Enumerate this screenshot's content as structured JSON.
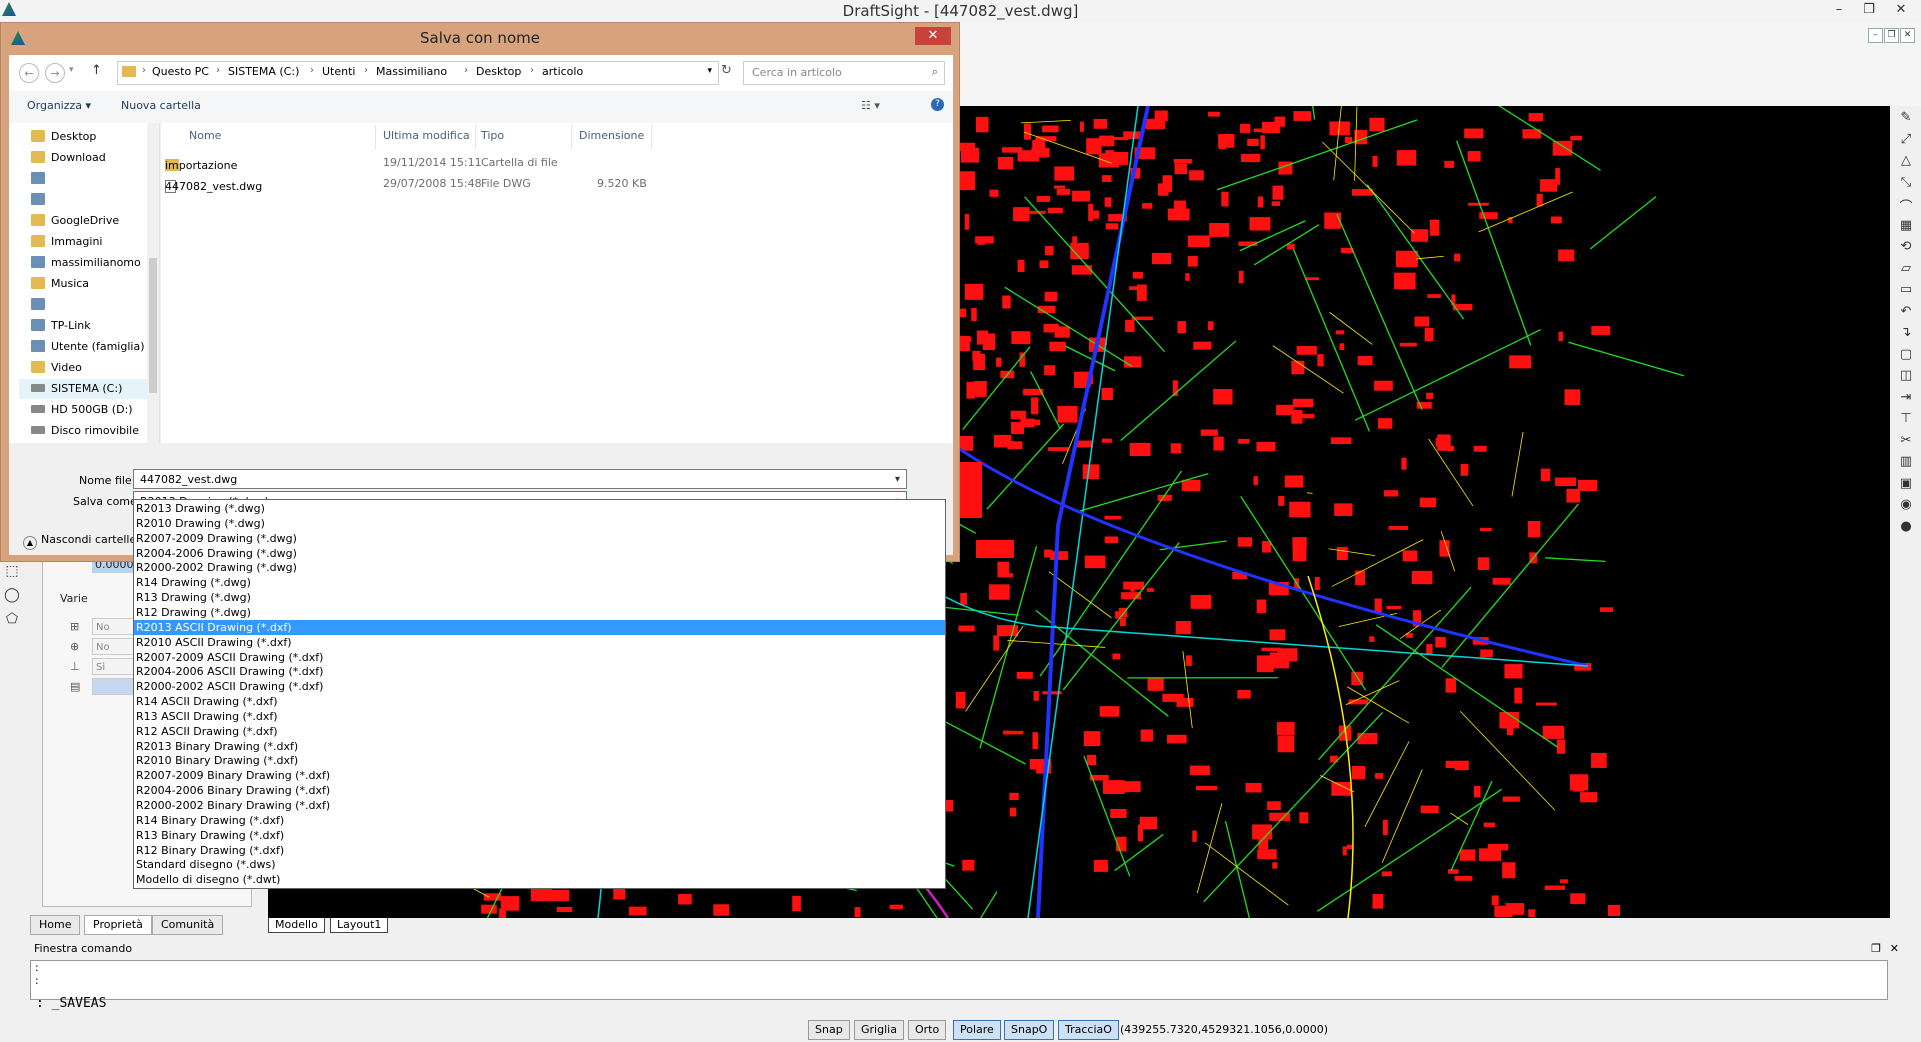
{
  "app": {
    "title": "DraftSight - [447082_vest.dwg]",
    "window_controls": [
      "–",
      "❐",
      "✕"
    ]
  },
  "dialog": {
    "title": "Salva con nome",
    "close_label": "✕",
    "breadcrumb": [
      "Questo PC",
      "SISTEMA (C:)",
      "Utenti",
      "Massimiliano",
      "Desktop",
      "articolo"
    ],
    "search_placeholder": "Cerca in articolo",
    "toolbar": {
      "organize": "Organizza ▾",
      "new_folder": "Nuova cartella"
    },
    "nav_items": [
      {
        "label": "Desktop",
        "icon": "folder-icon"
      },
      {
        "label": "Download",
        "icon": "folder-icon"
      },
      {
        "label": "",
        "icon": "computer-icon"
      },
      {
        "label": "",
        "icon": "computer-icon"
      },
      {
        "label": "GoogleDrive",
        "icon": "folder-icon"
      },
      {
        "label": "Immagini",
        "icon": "folder-icon"
      },
      {
        "label": "massimilianomo",
        "icon": "computer-icon"
      },
      {
        "label": "Musica",
        "icon": "folder-icon"
      },
      {
        "label": "",
        "icon": "computer-icon"
      },
      {
        "label": "TP-Link",
        "icon": "computer-icon"
      },
      {
        "label": "Utente (famiglia)",
        "icon": "computer-icon"
      },
      {
        "label": "Video",
        "icon": "folder-icon"
      },
      {
        "label": "SISTEMA (C:)",
        "icon": "drive-icon"
      },
      {
        "label": "HD 500GB (D:)",
        "icon": "drive-icon"
      },
      {
        "label": "Disco rimovibile",
        "icon": "drive-icon"
      }
    ],
    "columns": {
      "name": "Nome",
      "modified": "Ultima modifica",
      "type": "Tipo",
      "size": "Dimensione"
    },
    "files": [
      {
        "name": "importazione",
        "modified": "19/11/2014 15:11",
        "type": "Cartella di file",
        "size": ""
      },
      {
        "name": "447082_vest.dwg",
        "modified": "29/07/2008 15:48",
        "type": "File DWG",
        "size": "9.520 KB"
      }
    ],
    "filename_label": "Nome file:",
    "filename_value": "447082_vest.dwg",
    "saveas_label": "Salva come:",
    "saveas_value": "R2013 Drawing (*.dwg)",
    "hide_folders": "Nascondi cartelle",
    "saveas_options": [
      "R2013 Drawing (*.dwg)",
      "R2010 Drawing (*.dwg)",
      "R2007-2009 Drawing (*.dwg)",
      "R2004-2006 Drawing (*.dwg)",
      "R2000-2002 Drawing (*.dwg)",
      "R14 Drawing (*.dwg)",
      "R13 Drawing (*.dwg)",
      "R12 Drawing (*.dwg)",
      "R2013 ASCII Drawing (*.dxf)",
      "R2010 ASCII Drawing (*.dxf)",
      "R2007-2009 ASCII Drawing (*.dxf)",
      "R2004-2006 ASCII Drawing (*.dxf)",
      "R2000-2002 ASCII Drawing (*.dxf)",
      "R14 ASCII Drawing (*.dxf)",
      "R13 ASCII Drawing (*.dxf)",
      "R12 ASCII Drawing (*.dxf)",
      "R2013 Binary Drawing (*.dxf)",
      "R2010 Binary Drawing (*.dxf)",
      "R2007-2009 Binary Drawing (*.dxf)",
      "R2004-2006 Binary Drawing (*.dxf)",
      "R2000-2002 Binary Drawing (*.dxf)",
      "R14 Binary Drawing (*.dxf)",
      "R13 Binary Drawing (*.dxf)",
      "R12 Binary Drawing (*.dxf)",
      "Standard disegno (*.dws)",
      "Modello di disegno (*.dwt)"
    ],
    "selected_option_index": 8
  },
  "properties": {
    "zoom_value": "0.0000",
    "varie_label": "Varie",
    "rows": [
      "No",
      "No",
      "Sì",
      ""
    ]
  },
  "panel_tabs": [
    "Home",
    "Proprietà",
    "Comunità"
  ],
  "layout_tabs": [
    "Modello",
    "Layout1"
  ],
  "command": {
    "title": "Finestra comando",
    "history": [
      ":",
      ":"
    ],
    "input": ": _SAVEAS"
  },
  "status": {
    "buttons": [
      {
        "label": "Snap",
        "on": false
      },
      {
        "label": "Griglia",
        "on": false
      },
      {
        "label": "Orto",
        "on": false
      },
      {
        "label": "Polare",
        "on": true
      },
      {
        "label": "SnapO",
        "on": true
      },
      {
        "label": "TracciaO",
        "on": true
      }
    ],
    "coords": "(439255.7320,4529321.1056,0.0000)"
  },
  "colors": {
    "dialog_frame": "#d7a37d",
    "selection": "#3399ff",
    "map_buildings": "#ff1010",
    "map_roads": "#22dd22",
    "map_lines": "#ffee00",
    "map_railway": "#2233ff",
    "map_highway": "#00d8d8",
    "map_magenta": "#d020c0"
  }
}
